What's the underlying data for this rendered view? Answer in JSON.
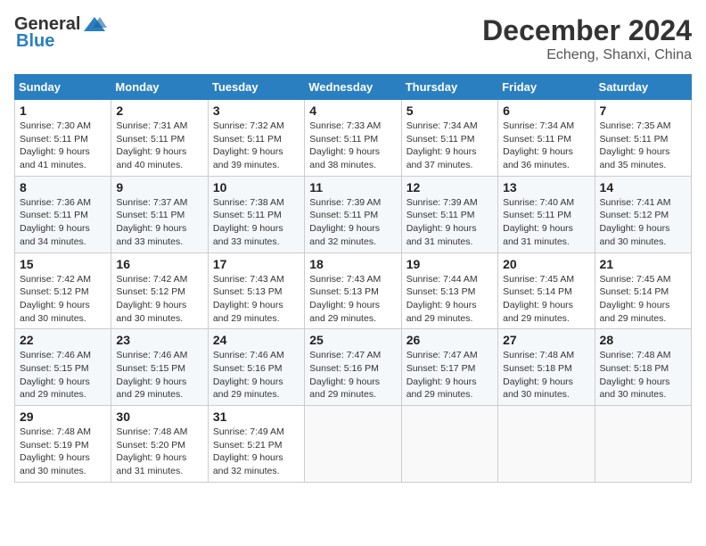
{
  "header": {
    "logo_general": "General",
    "logo_blue": "Blue",
    "month_title": "December 2024",
    "location": "Echeng, Shanxi, China"
  },
  "weekdays": [
    "Sunday",
    "Monday",
    "Tuesday",
    "Wednesday",
    "Thursday",
    "Friday",
    "Saturday"
  ],
  "weeks": [
    [
      {
        "day": "1",
        "sunrise": "Sunrise: 7:30 AM",
        "sunset": "Sunset: 5:11 PM",
        "daylight": "Daylight: 9 hours and 41 minutes."
      },
      {
        "day": "2",
        "sunrise": "Sunrise: 7:31 AM",
        "sunset": "Sunset: 5:11 PM",
        "daylight": "Daylight: 9 hours and 40 minutes."
      },
      {
        "day": "3",
        "sunrise": "Sunrise: 7:32 AM",
        "sunset": "Sunset: 5:11 PM",
        "daylight": "Daylight: 9 hours and 39 minutes."
      },
      {
        "day": "4",
        "sunrise": "Sunrise: 7:33 AM",
        "sunset": "Sunset: 5:11 PM",
        "daylight": "Daylight: 9 hours and 38 minutes."
      },
      {
        "day": "5",
        "sunrise": "Sunrise: 7:34 AM",
        "sunset": "Sunset: 5:11 PM",
        "daylight": "Daylight: 9 hours and 37 minutes."
      },
      {
        "day": "6",
        "sunrise": "Sunrise: 7:34 AM",
        "sunset": "Sunset: 5:11 PM",
        "daylight": "Daylight: 9 hours and 36 minutes."
      },
      {
        "day": "7",
        "sunrise": "Sunrise: 7:35 AM",
        "sunset": "Sunset: 5:11 PM",
        "daylight": "Daylight: 9 hours and 35 minutes."
      }
    ],
    [
      {
        "day": "8",
        "sunrise": "Sunrise: 7:36 AM",
        "sunset": "Sunset: 5:11 PM",
        "daylight": "Daylight: 9 hours and 34 minutes."
      },
      {
        "day": "9",
        "sunrise": "Sunrise: 7:37 AM",
        "sunset": "Sunset: 5:11 PM",
        "daylight": "Daylight: 9 hours and 33 minutes."
      },
      {
        "day": "10",
        "sunrise": "Sunrise: 7:38 AM",
        "sunset": "Sunset: 5:11 PM",
        "daylight": "Daylight: 9 hours and 33 minutes."
      },
      {
        "day": "11",
        "sunrise": "Sunrise: 7:39 AM",
        "sunset": "Sunset: 5:11 PM",
        "daylight": "Daylight: 9 hours and 32 minutes."
      },
      {
        "day": "12",
        "sunrise": "Sunrise: 7:39 AM",
        "sunset": "Sunset: 5:11 PM",
        "daylight": "Daylight: 9 hours and 31 minutes."
      },
      {
        "day": "13",
        "sunrise": "Sunrise: 7:40 AM",
        "sunset": "Sunset: 5:11 PM",
        "daylight": "Daylight: 9 hours and 31 minutes."
      },
      {
        "day": "14",
        "sunrise": "Sunrise: 7:41 AM",
        "sunset": "Sunset: 5:12 PM",
        "daylight": "Daylight: 9 hours and 30 minutes."
      }
    ],
    [
      {
        "day": "15",
        "sunrise": "Sunrise: 7:42 AM",
        "sunset": "Sunset: 5:12 PM",
        "daylight": "Daylight: 9 hours and 30 minutes."
      },
      {
        "day": "16",
        "sunrise": "Sunrise: 7:42 AM",
        "sunset": "Sunset: 5:12 PM",
        "daylight": "Daylight: 9 hours and 30 minutes."
      },
      {
        "day": "17",
        "sunrise": "Sunrise: 7:43 AM",
        "sunset": "Sunset: 5:13 PM",
        "daylight": "Daylight: 9 hours and 29 minutes."
      },
      {
        "day": "18",
        "sunrise": "Sunrise: 7:43 AM",
        "sunset": "Sunset: 5:13 PM",
        "daylight": "Daylight: 9 hours and 29 minutes."
      },
      {
        "day": "19",
        "sunrise": "Sunrise: 7:44 AM",
        "sunset": "Sunset: 5:13 PM",
        "daylight": "Daylight: 9 hours and 29 minutes."
      },
      {
        "day": "20",
        "sunrise": "Sunrise: 7:45 AM",
        "sunset": "Sunset: 5:14 PM",
        "daylight": "Daylight: 9 hours and 29 minutes."
      },
      {
        "day": "21",
        "sunrise": "Sunrise: 7:45 AM",
        "sunset": "Sunset: 5:14 PM",
        "daylight": "Daylight: 9 hours and 29 minutes."
      }
    ],
    [
      {
        "day": "22",
        "sunrise": "Sunrise: 7:46 AM",
        "sunset": "Sunset: 5:15 PM",
        "daylight": "Daylight: 9 hours and 29 minutes."
      },
      {
        "day": "23",
        "sunrise": "Sunrise: 7:46 AM",
        "sunset": "Sunset: 5:15 PM",
        "daylight": "Daylight: 9 hours and 29 minutes."
      },
      {
        "day": "24",
        "sunrise": "Sunrise: 7:46 AM",
        "sunset": "Sunset: 5:16 PM",
        "daylight": "Daylight: 9 hours and 29 minutes."
      },
      {
        "day": "25",
        "sunrise": "Sunrise: 7:47 AM",
        "sunset": "Sunset: 5:16 PM",
        "daylight": "Daylight: 9 hours and 29 minutes."
      },
      {
        "day": "26",
        "sunrise": "Sunrise: 7:47 AM",
        "sunset": "Sunset: 5:17 PM",
        "daylight": "Daylight: 9 hours and 29 minutes."
      },
      {
        "day": "27",
        "sunrise": "Sunrise: 7:48 AM",
        "sunset": "Sunset: 5:18 PM",
        "daylight": "Daylight: 9 hours and 30 minutes."
      },
      {
        "day": "28",
        "sunrise": "Sunrise: 7:48 AM",
        "sunset": "Sunset: 5:18 PM",
        "daylight": "Daylight: 9 hours and 30 minutes."
      }
    ],
    [
      {
        "day": "29",
        "sunrise": "Sunrise: 7:48 AM",
        "sunset": "Sunset: 5:19 PM",
        "daylight": "Daylight: 9 hours and 30 minutes."
      },
      {
        "day": "30",
        "sunrise": "Sunrise: 7:48 AM",
        "sunset": "Sunset: 5:20 PM",
        "daylight": "Daylight: 9 hours and 31 minutes."
      },
      {
        "day": "31",
        "sunrise": "Sunrise: 7:49 AM",
        "sunset": "Sunset: 5:21 PM",
        "daylight": "Daylight: 9 hours and 32 minutes."
      },
      null,
      null,
      null,
      null
    ]
  ]
}
